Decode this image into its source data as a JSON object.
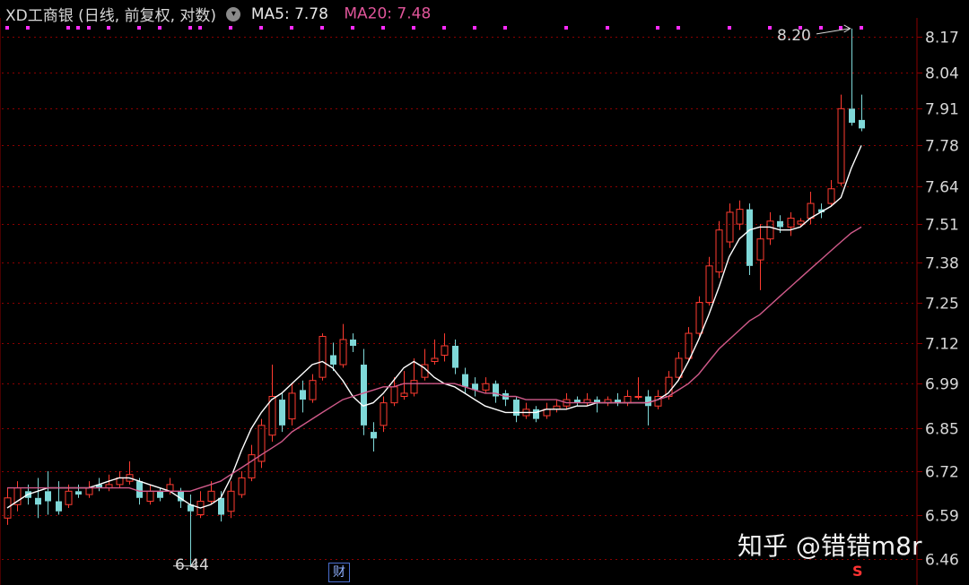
{
  "header": {
    "title": "XD工商银 (日线, 前复权, 对数)",
    "ma5_label": "MA5: 7.78",
    "ma20_label": "MA20: 7.48"
  },
  "annotations": {
    "high_label": "8.20",
    "low_label": "6.44",
    "cai_badge": "财",
    "s_badge": "S"
  },
  "watermark": "知乎 @错错m8r",
  "colors": {
    "up": "#ff3b30",
    "down": "#7fd8d8",
    "ma5": "#ffffff",
    "ma20": "#d05a8a",
    "grid": "#8b0000",
    "axis_text": "#d8d8d8",
    "signal_dots": "#ff2bff"
  },
  "chart_data": {
    "type": "candlestick",
    "scale": "log",
    "y_ticks": [
      8.17,
      8.04,
      7.91,
      7.78,
      7.64,
      7.51,
      7.38,
      7.25,
      7.12,
      6.99,
      6.85,
      6.72,
      6.59,
      6.46
    ],
    "ylim": [
      6.44,
      8.25
    ],
    "grid": true,
    "series": [
      {
        "name": "MA5",
        "values": [
          6.61,
          6.63,
          6.65,
          6.66,
          6.67,
          6.67,
          6.67,
          6.67,
          6.67,
          6.68,
          6.69,
          6.7,
          6.7,
          6.69,
          6.68,
          6.67,
          6.66,
          6.64,
          6.62,
          6.61,
          6.62,
          6.64,
          6.7,
          6.78,
          6.85,
          6.9,
          6.94,
          6.96,
          6.99,
          7.02,
          7.05,
          7.06,
          7.04,
          7.0,
          6.95,
          6.92,
          6.93,
          6.96,
          7.0,
          7.04,
          7.06,
          7.04,
          7.01,
          6.99,
          6.98,
          6.96,
          6.94,
          6.92,
          6.91,
          6.9,
          6.9,
          6.9,
          6.9,
          6.91,
          6.91,
          6.91,
          6.92,
          6.92,
          6.93,
          6.93,
          6.93,
          6.93,
          6.93,
          6.93,
          6.94,
          6.96,
          7.0,
          7.06,
          7.13,
          7.21,
          7.3,
          7.4,
          7.46,
          7.49,
          7.5,
          7.5,
          7.49,
          7.49,
          7.5,
          7.53,
          7.55,
          7.57,
          7.6,
          7.7,
          7.78
        ]
      },
      {
        "name": "MA20",
        "values": [
          6.67,
          6.67,
          6.67,
          6.67,
          6.67,
          6.67,
          6.67,
          6.67,
          6.67,
          6.67,
          6.67,
          6.67,
          6.67,
          6.66,
          6.66,
          6.66,
          6.66,
          6.66,
          6.66,
          6.67,
          6.68,
          6.69,
          6.71,
          6.73,
          6.75,
          6.77,
          6.79,
          6.81,
          6.84,
          6.86,
          6.88,
          6.9,
          6.92,
          6.94,
          6.95,
          6.96,
          6.97,
          6.98,
          6.98,
          6.99,
          6.99,
          6.99,
          6.99,
          6.99,
          6.99,
          6.98,
          6.97,
          6.96,
          6.96,
          6.95,
          6.95,
          6.94,
          6.94,
          6.94,
          6.94,
          6.93,
          6.93,
          6.93,
          6.93,
          6.93,
          6.93,
          6.93,
          6.93,
          6.93,
          6.94,
          6.95,
          6.97,
          6.99,
          7.02,
          7.06,
          7.1,
          7.13,
          7.16,
          7.19,
          7.21,
          7.24,
          7.27,
          7.3,
          7.33,
          7.36,
          7.39,
          7.42,
          7.45,
          7.48,
          7.5
        ]
      },
      {
        "name": "candles",
        "ohlc": [
          [
            6.58,
            6.64,
            6.67,
            6.56
          ],
          [
            6.62,
            6.67,
            6.69,
            6.6
          ],
          [
            6.66,
            6.64,
            6.68,
            6.62
          ],
          [
            6.64,
            6.62,
            6.7,
            6.58
          ],
          [
            6.66,
            6.63,
            6.72,
            6.59
          ],
          [
            6.63,
            6.6,
            6.69,
            6.59
          ],
          [
            6.62,
            6.66,
            6.68,
            6.61
          ],
          [
            6.66,
            6.65,
            6.68,
            6.64
          ],
          [
            6.65,
            6.67,
            6.69,
            6.64
          ],
          [
            6.68,
            6.67,
            6.7,
            6.66
          ],
          [
            6.67,
            6.68,
            6.71,
            6.66
          ],
          [
            6.68,
            6.7,
            6.72,
            6.67
          ],
          [
            6.69,
            6.71,
            6.75,
            6.68
          ],
          [
            6.69,
            6.64,
            6.7,
            6.62
          ],
          [
            6.63,
            6.66,
            6.68,
            6.62
          ],
          [
            6.66,
            6.64,
            6.67,
            6.63
          ],
          [
            6.66,
            6.68,
            6.7,
            6.65
          ],
          [
            6.66,
            6.63,
            6.67,
            6.61
          ],
          [
            6.62,
            6.6,
            6.65,
            6.44
          ],
          [
            6.59,
            6.63,
            6.66,
            6.58
          ],
          [
            6.63,
            6.66,
            6.69,
            6.62
          ],
          [
            6.64,
            6.59,
            6.66,
            6.57
          ],
          [
            6.6,
            6.66,
            6.69,
            6.58
          ],
          [
            6.65,
            6.7,
            6.72,
            6.64
          ],
          [
            6.7,
            6.77,
            6.8,
            6.69
          ],
          [
            6.75,
            6.86,
            6.88,
            6.73
          ],
          [
            6.83,
            6.95,
            7.05,
            6.81
          ],
          [
            6.94,
            6.86,
            6.96,
            6.84
          ],
          [
            6.88,
            6.96,
            6.99,
            6.86
          ],
          [
            6.97,
            6.94,
            7.0,
            6.9
          ],
          [
            6.94,
            7.0,
            7.02,
            6.93
          ],
          [
            7.01,
            7.14,
            7.15,
            7.0
          ],
          [
            7.08,
            7.05,
            7.12,
            7.03
          ],
          [
            7.05,
            7.13,
            7.18,
            7.04
          ],
          [
            7.13,
            7.11,
            7.15,
            7.09
          ],
          [
            7.05,
            6.86,
            7.1,
            6.83
          ],
          [
            6.84,
            6.82,
            6.87,
            6.78
          ],
          [
            6.86,
            6.93,
            6.95,
            6.84
          ],
          [
            6.93,
            6.98,
            7.01,
            6.92
          ],
          [
            6.95,
            6.96,
            7.03,
            6.94
          ],
          [
            6.96,
            7.0,
            7.07,
            6.95
          ],
          [
            7.01,
            7.05,
            7.1,
            7.0
          ],
          [
            7.06,
            7.07,
            7.13,
            7.05
          ],
          [
            7.08,
            7.11,
            7.15,
            7.06
          ],
          [
            7.11,
            7.04,
            7.13,
            7.02
          ],
          [
            7.02,
            6.98,
            7.04,
            6.96
          ],
          [
            6.99,
            6.97,
            7.01,
            6.95
          ],
          [
            6.97,
            6.99,
            7.01,
            6.96
          ],
          [
            6.99,
            6.95,
            7.0,
            6.93
          ],
          [
            6.96,
            6.94,
            6.97,
            6.92
          ],
          [
            6.94,
            6.89,
            6.95,
            6.87
          ],
          [
            6.89,
            6.91,
            6.93,
            6.88
          ],
          [
            6.91,
            6.88,
            6.92,
            6.87
          ],
          [
            6.89,
            6.91,
            6.93,
            6.88
          ],
          [
            6.91,
            6.92,
            6.94,
            6.9
          ],
          [
            6.92,
            6.94,
            6.96,
            6.91
          ],
          [
            6.94,
            6.93,
            6.95,
            6.92
          ],
          [
            6.93,
            6.94,
            6.96,
            6.92
          ],
          [
            6.94,
            6.93,
            6.95,
            6.9
          ],
          [
            6.93,
            6.94,
            6.95,
            6.92
          ],
          [
            6.94,
            6.93,
            6.96,
            6.92
          ],
          [
            6.93,
            6.95,
            6.97,
            6.92
          ],
          [
            6.95,
            6.95,
            7.01,
            6.94
          ],
          [
            6.95,
            6.92,
            6.97,
            6.86
          ],
          [
            6.92,
            6.95,
            6.97,
            6.91
          ],
          [
            6.95,
            7.01,
            7.03,
            6.94
          ],
          [
            7.01,
            7.07,
            7.09,
            7.0
          ],
          [
            7.07,
            7.15,
            7.17,
            7.06
          ],
          [
            7.15,
            7.25,
            7.27,
            7.14
          ],
          [
            7.25,
            7.37,
            7.4,
            7.24
          ],
          [
            7.35,
            7.49,
            7.52,
            7.33
          ],
          [
            7.45,
            7.55,
            7.58,
            7.43
          ],
          [
            7.51,
            7.56,
            7.59,
            7.49
          ],
          [
            7.56,
            7.37,
            7.58,
            7.34
          ],
          [
            7.39,
            7.46,
            7.51,
            7.29
          ],
          [
            7.46,
            7.52,
            7.55,
            7.44
          ],
          [
            7.52,
            7.5,
            7.54,
            7.48
          ],
          [
            7.5,
            7.53,
            7.55,
            7.47
          ],
          [
            7.51,
            7.52,
            7.53,
            7.5
          ],
          [
            7.53,
            7.58,
            7.62,
            7.51
          ],
          [
            7.56,
            7.55,
            7.58,
            7.53
          ],
          [
            7.58,
            7.63,
            7.66,
            7.57
          ],
          [
            7.65,
            7.91,
            7.96,
            7.64
          ],
          [
            7.91,
            7.86,
            8.2,
            7.85
          ],
          [
            7.87,
            7.84,
            7.96,
            7.83
          ]
        ]
      }
    ]
  }
}
